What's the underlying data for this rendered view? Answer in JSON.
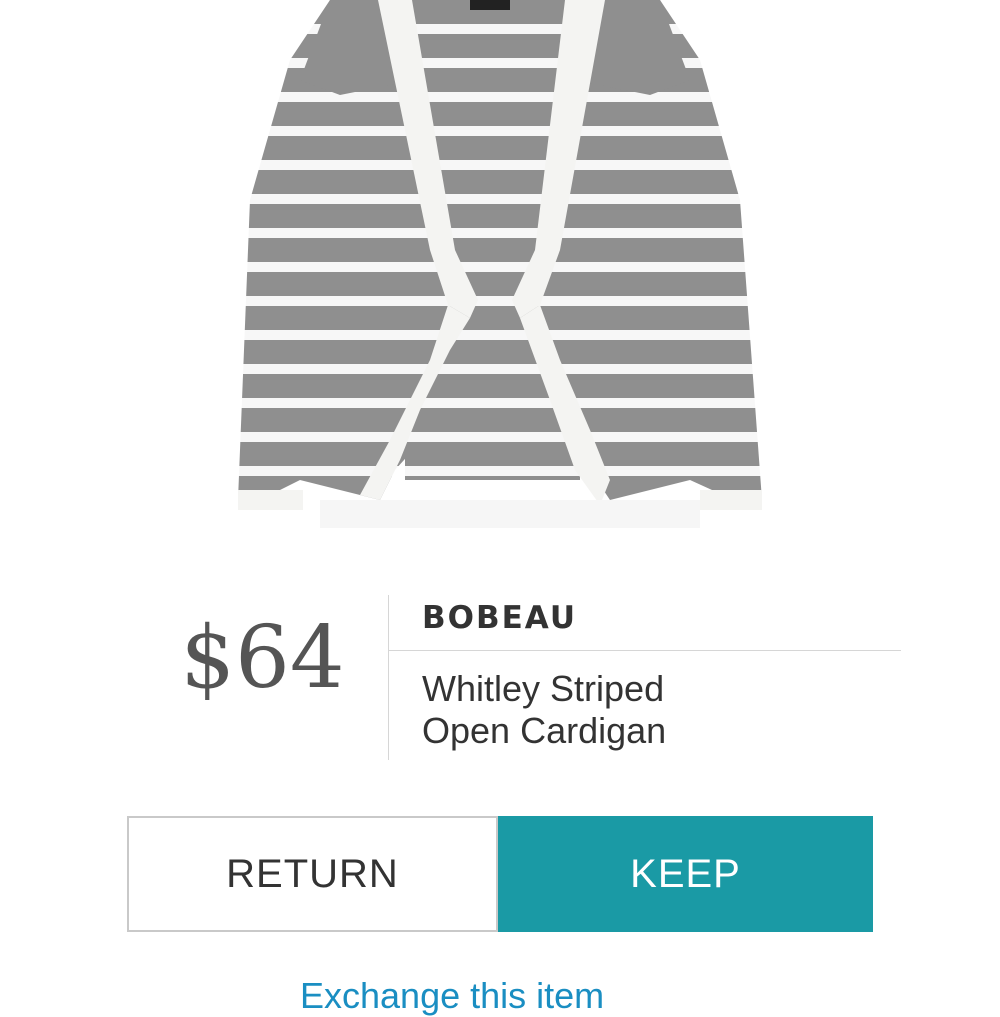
{
  "product": {
    "image_alt": "Whitley Striped Open Cardigan",
    "price": "$64",
    "brand": "BOBEAU",
    "name_line1": "Whitley Striped",
    "name_line2": "Open Cardigan"
  },
  "actions": {
    "return_label": "RETURN",
    "keep_label": "KEEP",
    "exchange_label": "Exchange this item"
  },
  "colors": {
    "accent": "#1a9aa5",
    "link": "#1a8ec2",
    "stripe_gray": "#8e8e8e",
    "trim": "#f4f4f2"
  }
}
